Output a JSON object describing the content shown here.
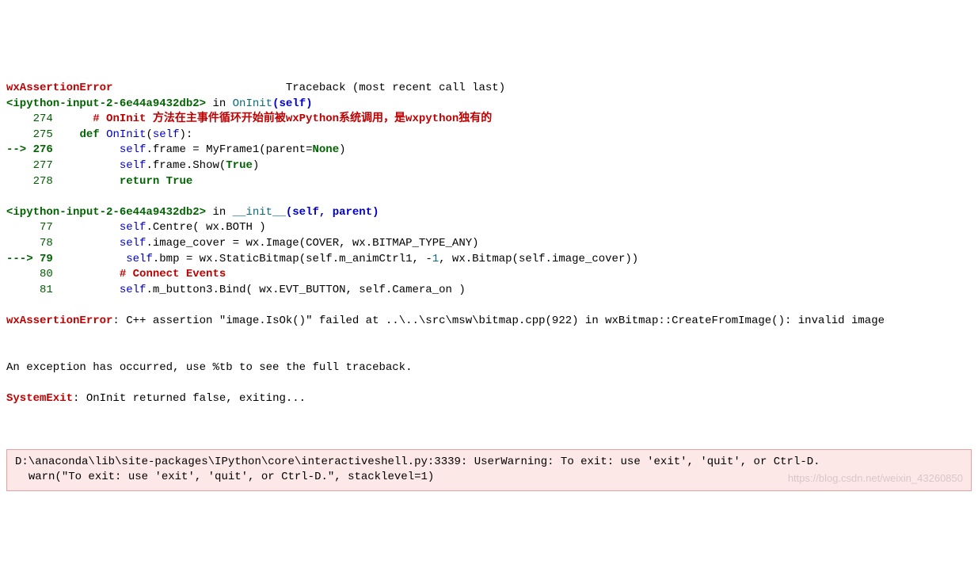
{
  "header": {
    "error_name": "wxAssertionError",
    "spacer": "                          ",
    "traceback": "Traceback (most recent call last)"
  },
  "frame1": {
    "source": "<ipython-input-2-6e44a9432db2>",
    "in": " in ",
    "func": "OnInit",
    "args_open": "(",
    "self": "self",
    "args_close": ")",
    "lines": {
      "274": {
        "num": "    274 ",
        "code_pre": "     ",
        "comment": "# OnInit 方法在主事件循环开始前被wxPython系统调用，是wxpython独有的"
      },
      "275": {
        "num": "    275 ",
        "code": "   ",
        "kw": "def",
        "sp": " ",
        "fn": "OnInit",
        "p": "(",
        "s": "self",
        "c": "):"
      },
      "276": {
        "arrow": "--> ",
        "num": "276 ",
        "indent": "         ",
        "s": "self",
        "t1": ".frame = MyFrame1(parent=",
        "none": "None",
        "t2": ")"
      },
      "277": {
        "num": "    277 ",
        "indent": "         ",
        "s": "self",
        "t1": ".frame.Show(",
        "true": "True",
        "t2": ")"
      },
      "278": {
        "num": "    278 ",
        "indent": "         ",
        "ret": "return",
        "sp": " ",
        "true": "True"
      }
    }
  },
  "frame2": {
    "source": "<ipython-input-2-6e44a9432db2>",
    "in": " in ",
    "func": "__init__",
    "args_open": "(",
    "self": "self",
    "comma": ", ",
    "parent": "parent",
    "args_close": ")",
    "lines": {
      "77": {
        "num": "     77 ",
        "indent": "         ",
        "s": "self",
        "t": ".Centre( wx.BOTH )"
      },
      "78": {
        "num": "     78 ",
        "indent": "         ",
        "s": "self",
        "t": ".image_cover = wx.Image(COVER, wx.BITMAP_TYPE_ANY)"
      },
      "79": {
        "arrow": "---> ",
        "num": "79 ",
        "indent": "          ",
        "s": "self",
        "t1": ".bmp = wx.StaticBitmap(self.m_animCtrl1, -",
        "one": "1",
        "t2": ", wx.Bitmap(self.image_cover))"
      },
      "80": {
        "num": "     80 ",
        "indent": "         ",
        "comment": "# Connect Events"
      },
      "81": {
        "num": "     81 ",
        "indent": "         ",
        "s": "self",
        "t": ".m_button3.Bind( wx.EVT_BUTTON, self.Camera_on )"
      }
    }
  },
  "error": {
    "name": "wxAssertionError",
    "colon": ": ",
    "msg": "C++ assertion \"image.IsOk()\" failed at ..\\..\\src\\msw\\bitmap.cpp(922) in wxBitmap::CreateFromImage(): invalid image"
  },
  "exception_hint": "An exception has occurred, use %tb to see the full traceback.",
  "systemexit": {
    "name": "SystemExit",
    "colon": ": ",
    "msg": "OnInit returned false, exiting..."
  },
  "warning": {
    "text": "D:\\anaconda\\lib\\site-packages\\IPython\\core\\interactiveshell.py:3339: UserWarning: To exit: use 'exit', 'quit', or Ctrl-D.\n  warn(\"To exit: use 'exit', 'quit', or Ctrl-D.\", stacklevel=1)"
  },
  "watermark": "https://blog.csdn.net/weixin_43260850"
}
